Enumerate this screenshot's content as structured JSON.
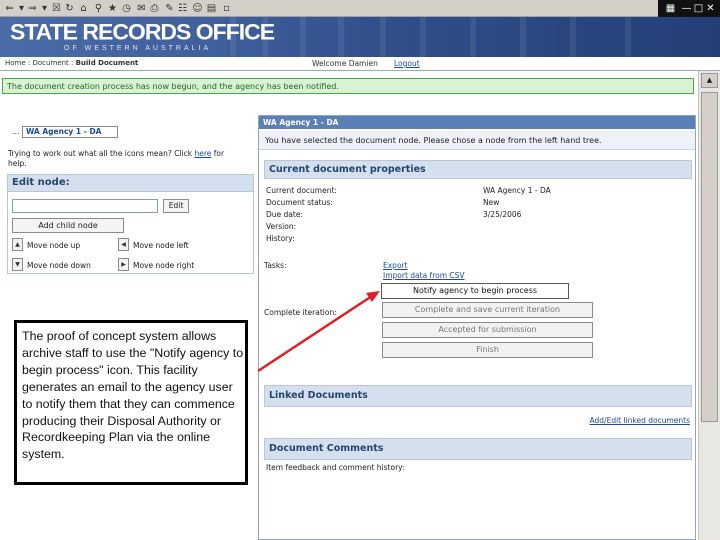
{
  "banner": {
    "title": "STATE RECORDS OFFICE",
    "subtitle": "OF WESTERN AUSTRALIA"
  },
  "nav": {
    "breadcrumb_home": "Home",
    "breadcrumb_sep": ":",
    "breadcrumb_document": "Document",
    "breadcrumb_current": "Build Document",
    "welcome": "Welcome Damien",
    "logout": "Logout"
  },
  "notification": {
    "text": "The document creation process has now begun, and the agency has been notified.",
    "color": "#d9f2d3"
  },
  "tree": {
    "dots": "...",
    "node_label": "WA Agency 1 - DA"
  },
  "help": {
    "text": "Trying to work out what all the icons mean? Click",
    "link": "here",
    "suffix": "for help."
  },
  "edit_node": {
    "title": "Edit node:",
    "input_value": "",
    "edit_button": "Edit",
    "add_child_button": "Add child node",
    "move_up": "Move node up",
    "move_left": "Move node left",
    "move_down": "Move node down",
    "move_right": "Move node right"
  },
  "content": {
    "header": "WA Agency 1 - DA",
    "selected_message": "You have selected the document node. Please chose a node from the left hand tree.",
    "properties_title": "Current document properties",
    "properties": [
      {
        "label": "Current document:",
        "value": "WA Agency 1 - DA"
      },
      {
        "label": "Document status:",
        "value": "New"
      },
      {
        "label": "Due date:",
        "value": "3/25/2006"
      },
      {
        "label": "Version:",
        "value": ""
      },
      {
        "label": "History:",
        "value": ""
      }
    ],
    "tasks_label": "Tasks:",
    "export_link": "Export",
    "import_link": "Import data from CSV",
    "complete_label": "Complete iteration:",
    "notify_button": "Notify agency to begin process",
    "complete_button": "Complete and save current iteration",
    "accepted_button": "Accepted for submission",
    "finish_button": "Finish",
    "linked_title": "Linked Documents",
    "linked_link": "Add/Edit linked documents",
    "comments_title": "Document Comments",
    "comments_sub": "Item feedback and comment history:"
  },
  "callout": {
    "text": "The proof of concept system allows archive staff to use the \"Notify agency to begin process\" icon. This facility generates an email to the agency user to notify them that they can commence producing their Disposal Authority or Recordkeeping Plan via the online system.",
    "arrow_color": "#e31b23"
  }
}
